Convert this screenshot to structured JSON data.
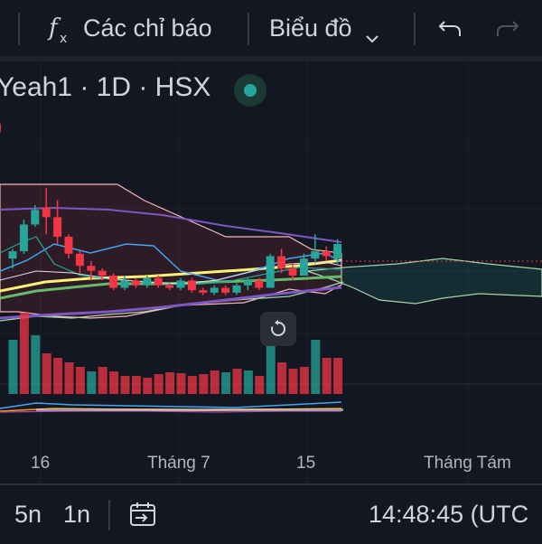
{
  "toolbar": {
    "indicators_label": "Các chỉ báo",
    "chart_type_label": "Biểu đồ",
    "icons": [
      "fx-icon",
      "chevron-down-icon",
      "undo-icon",
      "redo-icon"
    ]
  },
  "legend": {
    "symbol_text": "Yeah1 · 1D · HSX",
    "partial_paren": ")",
    "status_color": "#26a69a"
  },
  "time_axis": {
    "labels": [
      "16",
      "Tháng 7",
      "15",
      "Tháng Tám"
    ]
  },
  "bottom_bar": {
    "range_5n": "5n",
    "range_1n": "1n",
    "clock": "14:48:45 (UTC"
  },
  "colors": {
    "up": "#26a69a",
    "down": "#f23645",
    "background": "#131722"
  },
  "chart_data": {
    "type": "candlestick",
    "note_series": [
      "price",
      "volume",
      "ichimoku-cloud",
      "moving-averages",
      "bollinger"
    ],
    "candles": [
      {
        "o": 50.0,
        "h": 52.0,
        "l": 48.0,
        "c": 51.5
      },
      {
        "o": 51.5,
        "h": 58.0,
        "l": 51.0,
        "c": 57.0
      },
      {
        "o": 57.0,
        "h": 61.0,
        "l": 56.5,
        "c": 60.0
      },
      {
        "o": 60.5,
        "h": 64.5,
        "l": 55.0,
        "c": 58.5
      },
      {
        "o": 58.5,
        "h": 62.0,
        "l": 53.0,
        "c": 54.5
      },
      {
        "o": 54.5,
        "h": 55.0,
        "l": 50.0,
        "c": 51.0
      },
      {
        "o": 51.0,
        "h": 51.5,
        "l": 47.0,
        "c": 48.5
      },
      {
        "o": 48.5,
        "h": 49.5,
        "l": 45.5,
        "c": 47.5
      },
      {
        "o": 47.5,
        "h": 48.0,
        "l": 45.5,
        "c": 46.5
      },
      {
        "o": 46.5,
        "h": 47.0,
        "l": 43.5,
        "c": 44.0
      },
      {
        "o": 44.0,
        "h": 46.5,
        "l": 43.5,
        "c": 45.5
      },
      {
        "o": 45.5,
        "h": 46.0,
        "l": 44.0,
        "c": 44.5
      },
      {
        "o": 44.5,
        "h": 46.5,
        "l": 44.0,
        "c": 46.0
      },
      {
        "o": 46.0,
        "h": 46.5,
        "l": 44.0,
        "c": 44.5
      },
      {
        "o": 44.5,
        "h": 45.0,
        "l": 43.5,
        "c": 44.0
      },
      {
        "o": 44.0,
        "h": 46.0,
        "l": 43.5,
        "c": 45.5
      },
      {
        "o": 45.5,
        "h": 46.0,
        "l": 43.0,
        "c": 43.5
      },
      {
        "o": 43.5,
        "h": 44.0,
        "l": 42.5,
        "c": 43.0
      },
      {
        "o": 43.0,
        "h": 44.5,
        "l": 42.5,
        "c": 44.0
      },
      {
        "o": 44.0,
        "h": 44.5,
        "l": 42.5,
        "c": 43.0
      },
      {
        "o": 43.0,
        "h": 45.0,
        "l": 42.5,
        "c": 44.5
      },
      {
        "o": 44.5,
        "h": 46.0,
        "l": 43.5,
        "c": 45.5
      },
      {
        "o": 45.5,
        "h": 46.0,
        "l": 43.5,
        "c": 44.0
      },
      {
        "o": 44.0,
        "h": 51.0,
        "l": 44.0,
        "c": 50.5
      },
      {
        "o": 50.5,
        "h": 52.0,
        "l": 47.0,
        "c": 48.0
      },
      {
        "o": 48.0,
        "h": 49.0,
        "l": 45.5,
        "c": 46.5
      },
      {
        "o": 46.5,
        "h": 51.0,
        "l": 46.5,
        "c": 50.0
      },
      {
        "o": 50.0,
        "h": 55.0,
        "l": 49.0,
        "c": 51.5
      },
      {
        "o": 51.5,
        "h": 52.5,
        "l": 49.5,
        "c": 50.5
      },
      {
        "o": 50.0,
        "h": 54.0,
        "l": 49.0,
        "c": 53.0
      }
    ],
    "volumes": [
      {
        "v": 6.0,
        "up": true
      },
      {
        "v": 9.0,
        "up": false
      },
      {
        "v": 6.5,
        "up": true
      },
      {
        "v": 4.5,
        "up": false
      },
      {
        "v": 4.0,
        "up": false
      },
      {
        "v": 3.5,
        "up": false
      },
      {
        "v": 3.0,
        "up": false
      },
      {
        "v": 2.5,
        "up": true
      },
      {
        "v": 3.0,
        "up": false
      },
      {
        "v": 2.5,
        "up": false
      },
      {
        "v": 2.0,
        "up": false
      },
      {
        "v": 2.0,
        "up": false
      },
      {
        "v": 1.8,
        "up": false
      },
      {
        "v": 2.2,
        "up": false
      },
      {
        "v": 2.4,
        "up": false
      },
      {
        "v": 2.3,
        "up": false
      },
      {
        "v": 2.0,
        "up": false
      },
      {
        "v": 2.2,
        "up": false
      },
      {
        "v": 2.6,
        "up": false
      },
      {
        "v": 2.4,
        "up": true
      },
      {
        "v": 2.8,
        "up": false
      },
      {
        "v": 2.6,
        "up": true
      },
      {
        "v": 2.0,
        "up": false
      },
      {
        "v": 5.5,
        "up": true
      },
      {
        "v": 3.5,
        "up": false
      },
      {
        "v": 2.8,
        "up": false
      },
      {
        "v": 3.0,
        "up": false
      },
      {
        "v": 6.0,
        "up": true
      },
      {
        "v": 4.0,
        "up": false
      },
      {
        "v": 4.0,
        "up": false
      }
    ]
  }
}
